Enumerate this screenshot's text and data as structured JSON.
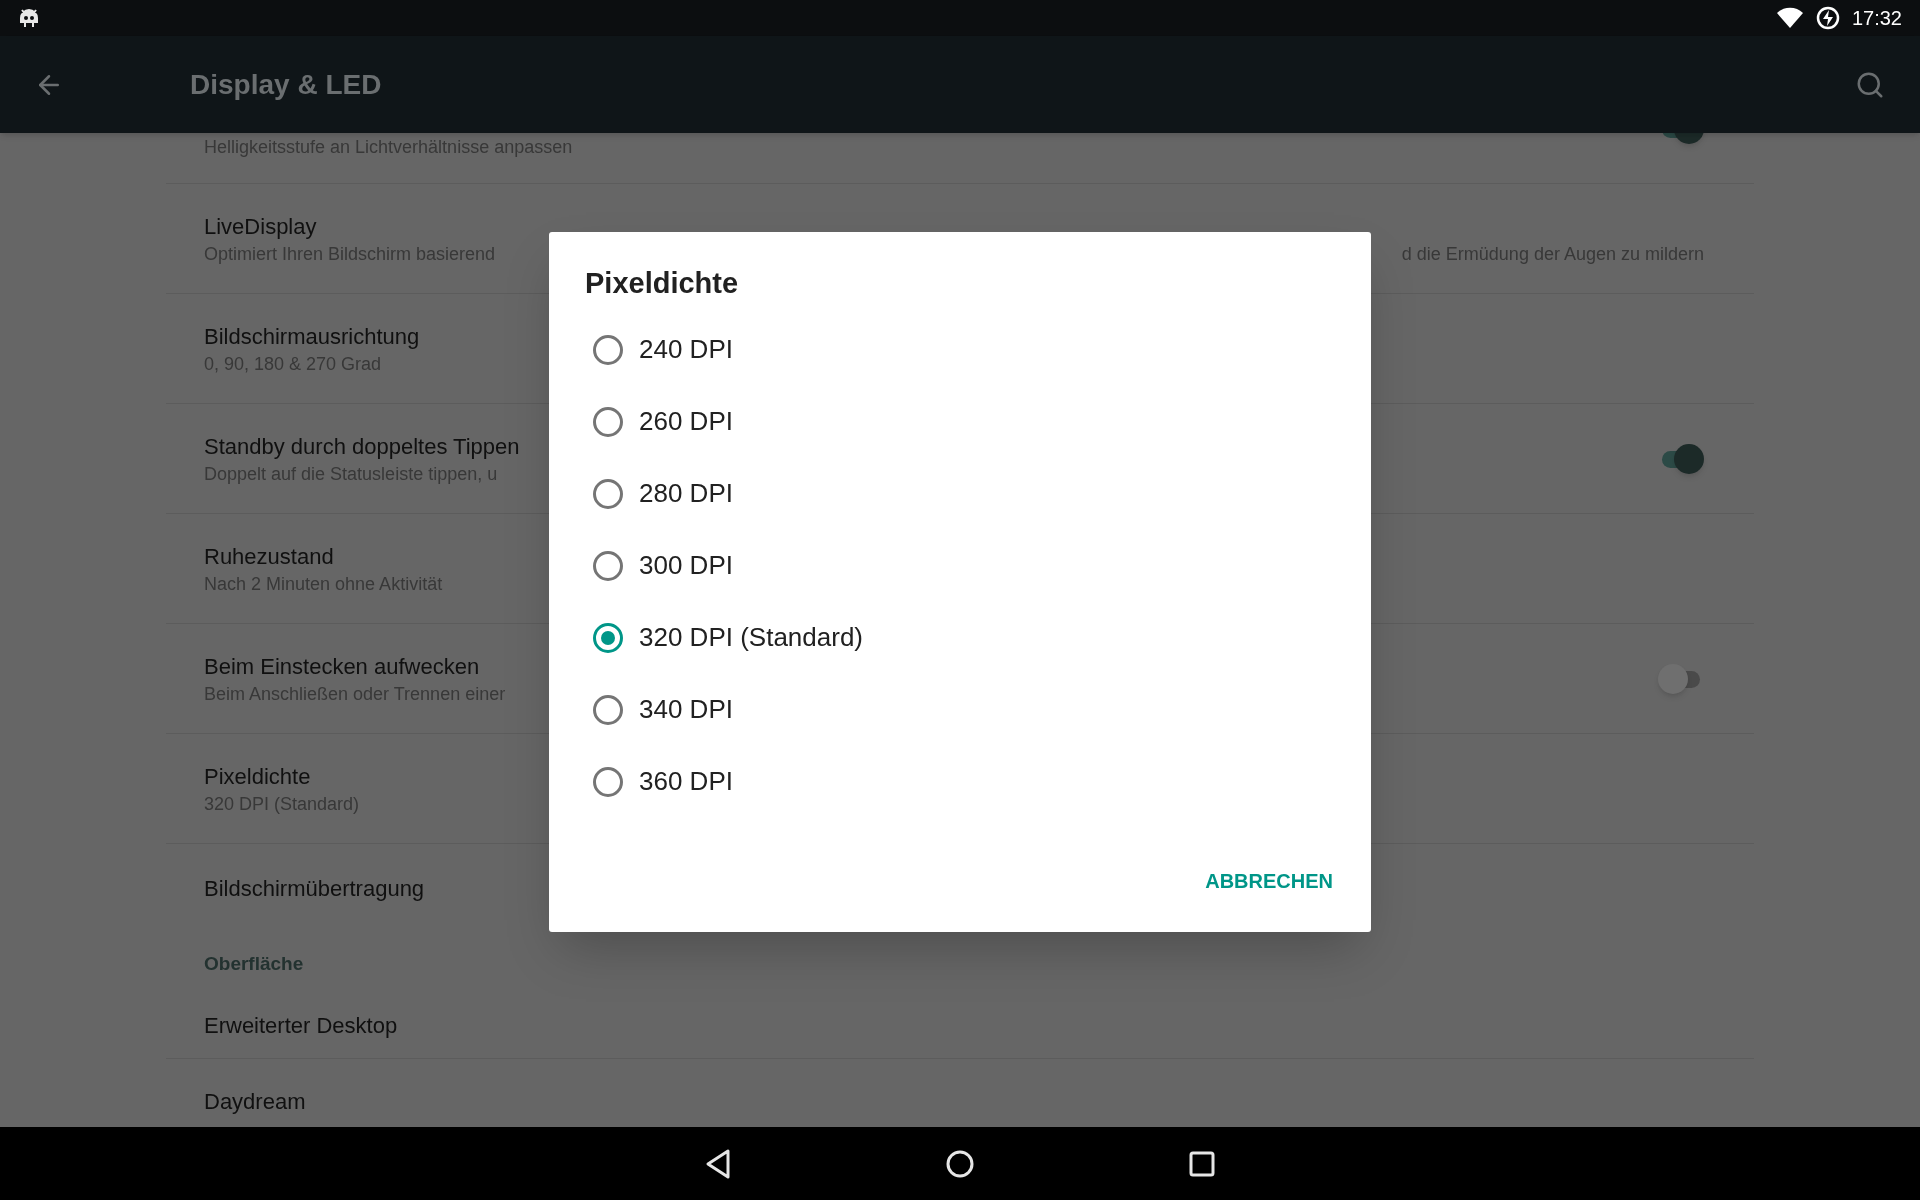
{
  "status_bar": {
    "time": "17:32"
  },
  "toolbar": {
    "title": "Display & LED"
  },
  "settings": [
    {
      "kind": "item",
      "subtitle": "Helligkeitsstufe an Lichtverhältnisse anpassen",
      "switch": {
        "on": true
      }
    },
    {
      "kind": "item",
      "title": "LiveDisplay",
      "subtitle": "Optimiert Ihren Bildschirm basierend",
      "subtitle_right": "d die Ermüdung der Augen zu mildern"
    },
    {
      "kind": "item",
      "title": "Bildschirmausrichtung",
      "subtitle": "0, 90, 180 & 270 Grad"
    },
    {
      "kind": "item",
      "title": "Standby durch doppeltes Tippen",
      "subtitle": "Doppelt auf die Statusleiste tippen, u",
      "switch": {
        "on": true
      }
    },
    {
      "kind": "item",
      "title": "Ruhezustand",
      "subtitle": "Nach 2 Minuten ohne Aktivität"
    },
    {
      "kind": "item",
      "title": "Beim Einstecken aufwecken",
      "subtitle": "Beim Anschließen oder Trennen einer",
      "switch": {
        "on": false
      }
    },
    {
      "kind": "item",
      "title": "Pixeldichte",
      "subtitle": "320 DPI (Standard)"
    },
    {
      "kind": "item",
      "title": "Bildschirmübertragung"
    },
    {
      "kind": "category",
      "title": "Oberfläche"
    },
    {
      "kind": "item",
      "title": "Erweiterter Desktop"
    },
    {
      "kind": "item",
      "title": "Daydream"
    }
  ],
  "dialog": {
    "title": "Pixeldichte",
    "options": [
      {
        "label": "240 DPI",
        "selected": false
      },
      {
        "label": "260 DPI",
        "selected": false
      },
      {
        "label": "280 DPI",
        "selected": false
      },
      {
        "label": "300 DPI",
        "selected": false
      },
      {
        "label": "320 DPI (Standard)",
        "selected": true
      },
      {
        "label": "340 DPI",
        "selected": false
      },
      {
        "label": "360 DPI",
        "selected": false
      }
    ],
    "buttons": [
      "ABBRECHEN"
    ]
  }
}
